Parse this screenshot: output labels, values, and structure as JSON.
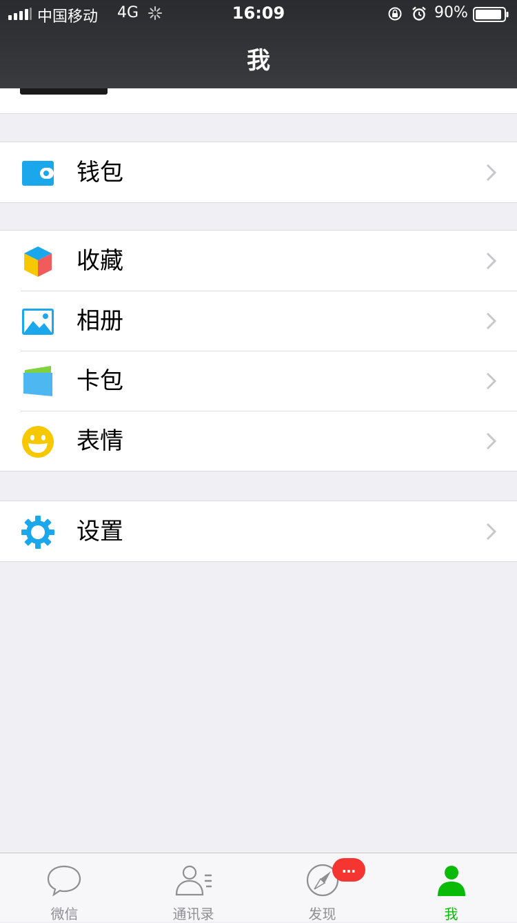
{
  "status": {
    "carrier": "中国移动",
    "network": "4G",
    "time": "16:09",
    "battery": "90%"
  },
  "header": {
    "title": "我"
  },
  "menu": {
    "wallet": "钱包",
    "favorites": "收藏",
    "album": "相册",
    "cards": "卡包",
    "stickers": "表情",
    "settings": "设置"
  },
  "tabs": [
    {
      "label": "微信",
      "icon": "chat-bubble-icon"
    },
    {
      "label": "通讯录",
      "icon": "contacts-icon"
    },
    {
      "label": "发现",
      "icon": "compass-icon"
    },
    {
      "label": "我",
      "icon": "me-icon"
    }
  ],
  "badge": "…",
  "colors": {
    "accent": "#09bb07",
    "icon_blue": "#1aa7ec",
    "badge_red": "#f43530",
    "sticker_yellow": "#f7c800"
  }
}
